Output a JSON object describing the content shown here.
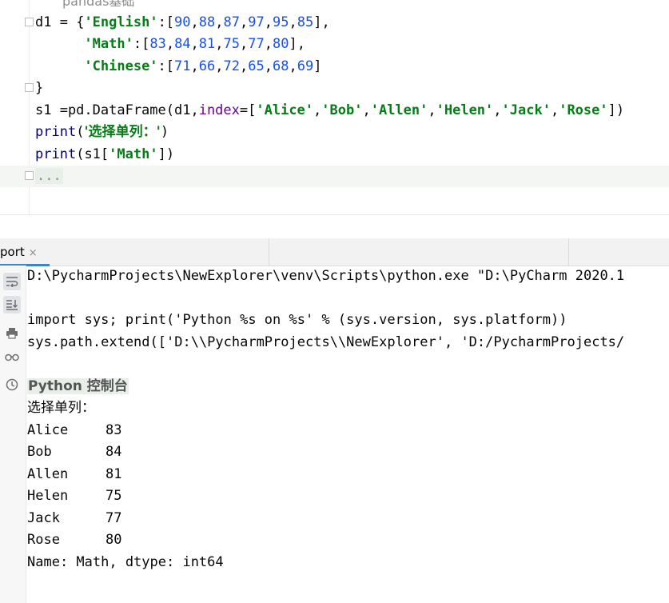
{
  "editor": {
    "header_comment": "pandas基础",
    "lines": [
      {
        "id": "l1"
      },
      {
        "id": "l2"
      },
      {
        "id": "l3"
      }
    ],
    "d1_name": "d1",
    "keys": [
      "'English'",
      "'Math'",
      "'Chinese'"
    ],
    "english_values": [
      "90",
      "88",
      "87",
      "97",
      "95",
      "85"
    ],
    "math_values": [
      "83",
      "84",
      "81",
      "75",
      "77",
      "80"
    ],
    "chinese_values": [
      "71",
      "66",
      "72",
      "65",
      "68",
      "69"
    ],
    "closing_brace": "}",
    "s1_prefix": "s1 =pd.DataFrame(d1,",
    "index_param": "index",
    "index_names": [
      "'Alice'",
      "'Bob'",
      "'Allen'",
      "'Helen'",
      "'Jack'",
      "'Rose'"
    ],
    "print1_func": "print",
    "print1_arg": "'选择单列：'",
    "print2_func": "print",
    "print2_arg_prefix": "s1[",
    "print2_arg_key": "'Math'",
    "print2_arg_suffix": "])",
    "collapsed": "..."
  },
  "run_window": {
    "tab_label": "port",
    "close_glyph": "×"
  },
  "console": {
    "cmd_line": "D:\\PycharmProjects\\NewExplorer\\venv\\Scripts\\python.exe \"D:\\PyCharm 2020.1",
    "import_line": "import sys; print('Python %s on %s' % (sys.version, sys.platform))",
    "path_line": "sys.path.extend(['D:\\\\PycharmProjects\\\\NewExplorer', 'D:/PycharmProjects/",
    "console_title": "Python 控制台",
    "output_label": "选择单列：",
    "rows": [
      {
        "name": "Alice",
        "value": "83"
      },
      {
        "name": "Bob",
        "value": "84"
      },
      {
        "name": "Allen",
        "value": "81"
      },
      {
        "name": "Helen",
        "value": "75"
      },
      {
        "name": "Jack",
        "value": "77"
      },
      {
        "name": "Rose",
        "value": "80"
      }
    ],
    "footer": "Name: Math, dtype: int64"
  },
  "toolbar_icons": [
    "soft-wrap-icon",
    "scroll-to-end-icon",
    "print-icon",
    "glasses-icon",
    "history-icon"
  ],
  "colors": {
    "string": "#067d17",
    "number": "#1750eb",
    "param": "#660099",
    "func": "#000080",
    "accent": "#4083c9"
  }
}
